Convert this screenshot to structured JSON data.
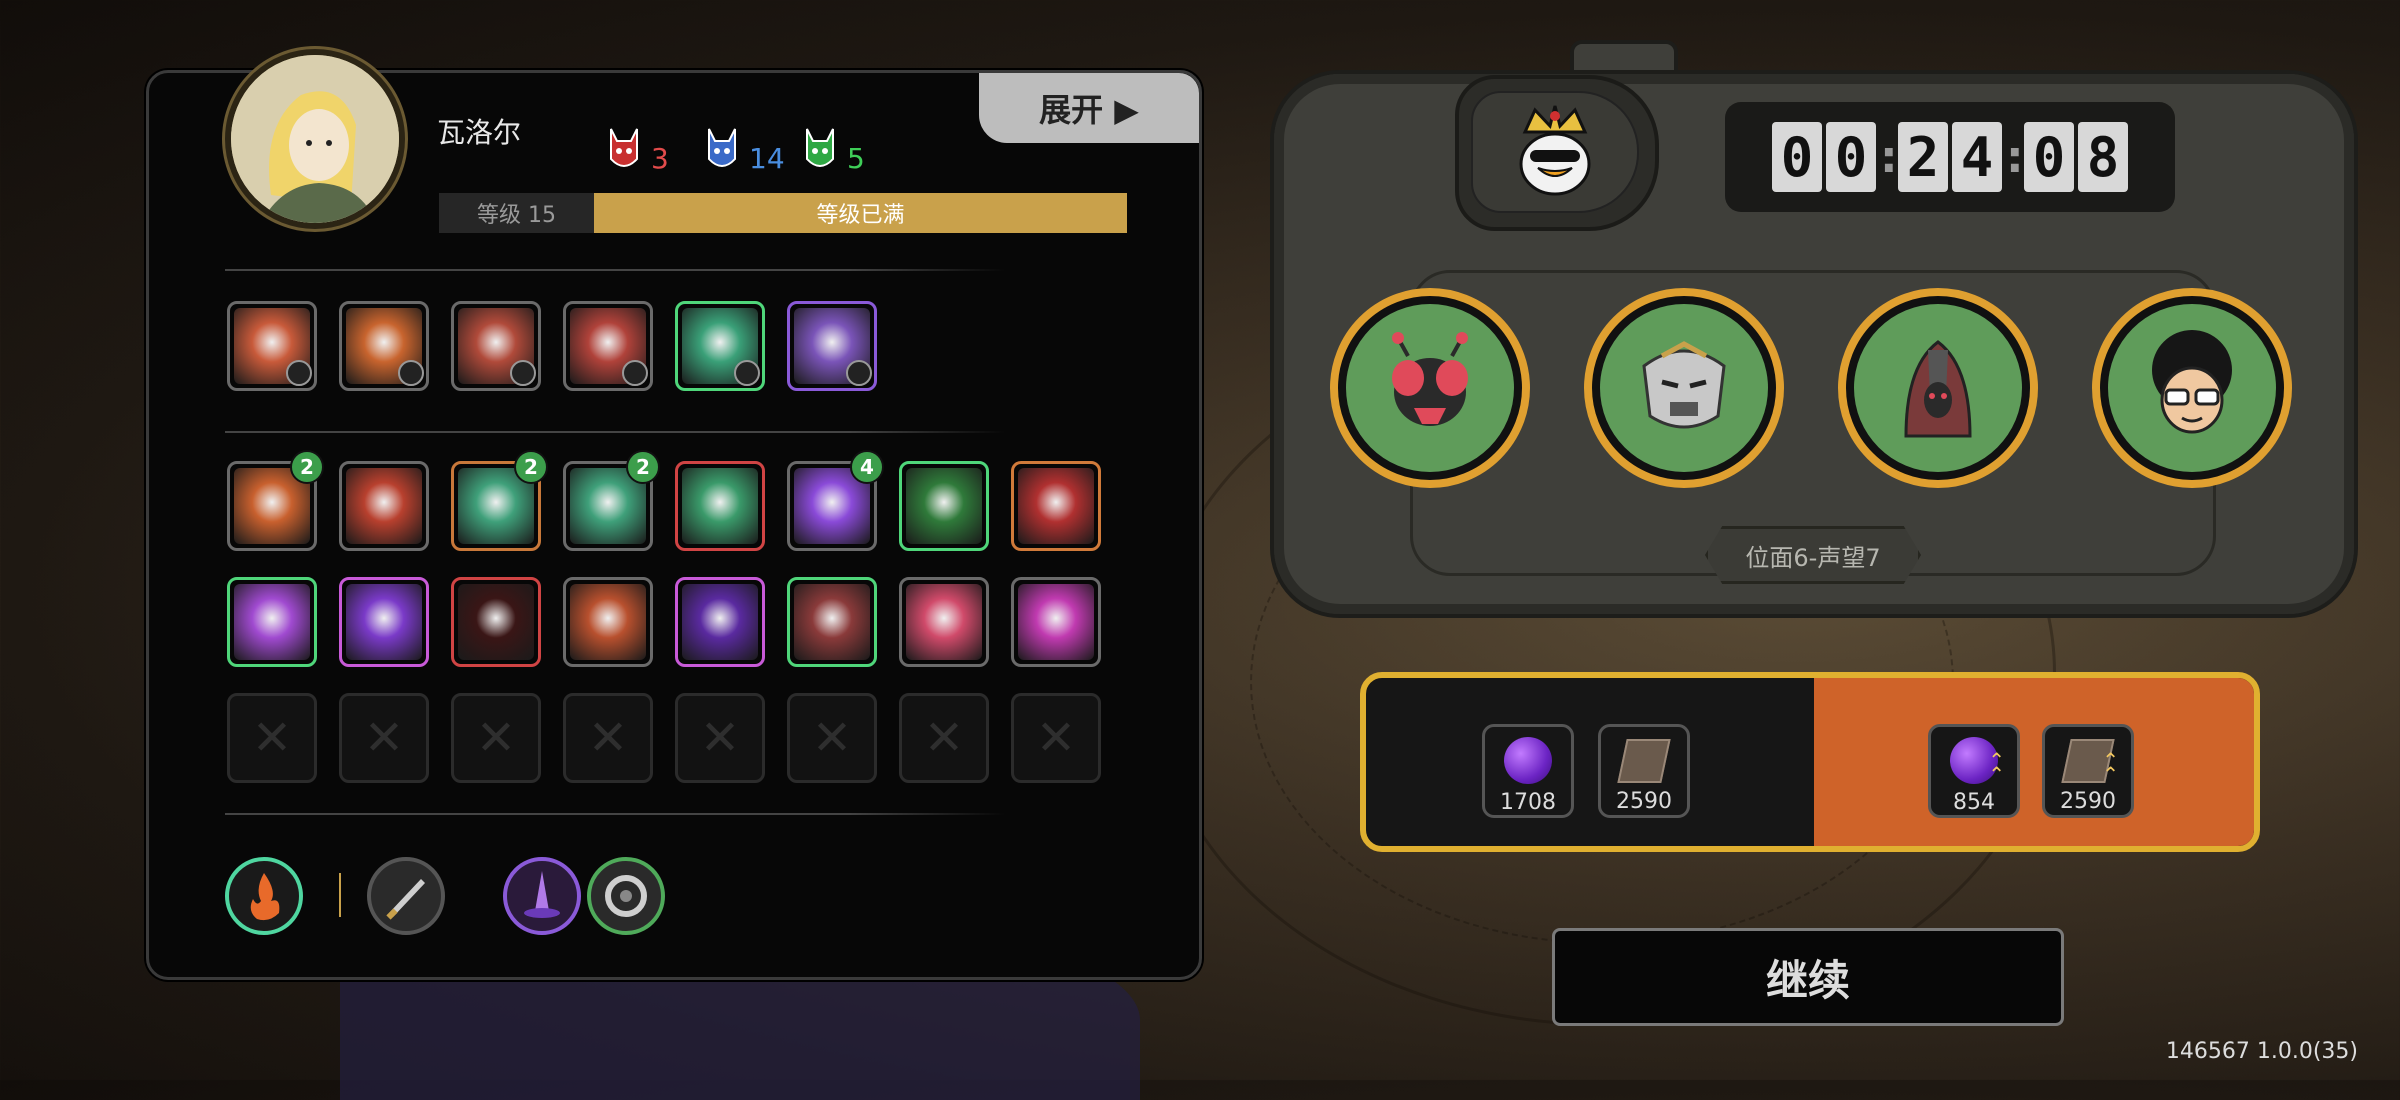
{
  "player": {
    "name": "瓦洛尔",
    "level_label": "等级 15",
    "level_status": "等级已满"
  },
  "stats": [
    {
      "icon": "red-mask-icon",
      "value": "3",
      "color": "#e24b4b"
    },
    {
      "icon": "blue-mask-icon",
      "value": "14",
      "color": "#4a8ee0"
    },
    {
      "icon": "green-mask-icon",
      "value": "5",
      "color": "#3fcf58"
    }
  ],
  "expand_label": "展开 ▶",
  "equipment_row": [
    {
      "icon": "claw-slash-skill-icon",
      "color": "#c85a3a",
      "border": "#6a6a6a"
    },
    {
      "icon": "flame-demon-skill-icon",
      "color": "#c8642e",
      "border": "#6a6a6a"
    },
    {
      "icon": "vortex-skill-icon",
      "color": "#b04a3a",
      "border": "#6a6a6a"
    },
    {
      "icon": "armor-skill-icon",
      "color": "#b0423a",
      "border": "#6a6a6a"
    },
    {
      "icon": "arrow-up-skill-icon",
      "color": "#3aa078",
      "border": "#4fd67a"
    },
    {
      "icon": "shield-plate-skill-icon",
      "color": "#7a54b8",
      "border": "#8a5ad8"
    }
  ],
  "buff_row1": [
    {
      "icon": "fire-blade-buff-icon",
      "color": "#c8602e",
      "border": "#6a6a6a",
      "count": "2"
    },
    {
      "icon": "flame-hand-buff-icon",
      "color": "#b8402e",
      "border": "#6a6a6a",
      "count": ""
    },
    {
      "icon": "spike-trap-buff-icon",
      "color": "#3fa07a",
      "border": "#c8783a",
      "count": "2"
    },
    {
      "icon": "radiant-burst-buff-icon",
      "color": "#3fa07a",
      "border": "#6a6a6a",
      "count": "2"
    },
    {
      "icon": "spear-volley-buff-icon",
      "color": "#3a9a6a",
      "border": "#d04444",
      "count": ""
    },
    {
      "icon": "pink-crystal-buff-icon",
      "color": "#8a4ad8",
      "border": "#6a6a6a",
      "count": "4"
    },
    {
      "icon": "green-bloom-buff-icon",
      "color": "#2f7a3a",
      "border": "#4fd67a",
      "count": ""
    },
    {
      "icon": "red-fang-buff-icon",
      "color": "#b03030",
      "border": "#d07a3a",
      "count": ""
    }
  ],
  "buff_row2": [
    {
      "icon": "purple-gear-buff-icon",
      "color": "#a04ad0",
      "border": "#4fd67a"
    },
    {
      "icon": "crescent-moon-buff-icon",
      "color": "#7a3ac8",
      "border": "#c85ad8"
    },
    {
      "icon": "red-cog-buff-icon",
      "color": "#3a1616",
      "border": "#d04444"
    },
    {
      "icon": "fire-pillar-buff-icon",
      "color": "#b8502e",
      "border": "#6a6a6a"
    },
    {
      "icon": "void-beast-buff-icon",
      "color": "#5a2aa0",
      "border": "#c85ad8"
    },
    {
      "icon": "crossed-blades-buff-icon",
      "color": "#8a3a3a",
      "border": "#4fd67a"
    },
    {
      "icon": "rose-portrait-buff-icon",
      "color": "#d04a6a",
      "border": "#6a6a6a"
    },
    {
      "icon": "magenta-demon-buff-icon",
      "color": "#c03ab0",
      "border": "#6a6a6a"
    }
  ],
  "empty_slots": [
    "✕",
    "✕",
    "✕",
    "✕",
    "✕",
    "✕",
    "✕",
    "✕"
  ],
  "bottom_items": [
    {
      "icon": "fire-orb-item-icon",
      "border": "#4fd6a0",
      "color": "#1a1a1a"
    },
    {
      "icon": "dagger-item-icon",
      "border": "#555555",
      "color": "#2a2a2a"
    },
    {
      "icon": "purple-spire-item-icon",
      "border": "#8a5ad8",
      "color": "#2a1a3a"
    },
    {
      "icon": "silver-ring-item-icon",
      "border": "#4faa5a",
      "color": "#2a2a2a"
    }
  ],
  "timer": {
    "digits": [
      "0",
      "0",
      "2",
      "4",
      "0",
      "8"
    ]
  },
  "boss_icon": "crowned-duck-boss-icon",
  "enemies": [
    {
      "icon": "red-bug-enemy-icon"
    },
    {
      "icon": "armored-knight-enemy-icon"
    },
    {
      "icon": "hooded-cultist-enemy-icon"
    },
    {
      "icon": "afro-glasses-enemy-icon"
    }
  ],
  "position_label": "位面6-声望7",
  "rewards": {
    "base": [
      {
        "icon": "purple-gem-icon",
        "value": "1708"
      },
      {
        "icon": "book-icon",
        "value": "2590"
      }
    ],
    "bonus": [
      {
        "icon": "purple-gem-up-icon",
        "value": "854"
      },
      {
        "icon": "book-up-icon",
        "value": "2590"
      }
    ]
  },
  "continue_label": "继续",
  "version": "146567 1.0.0(35)"
}
